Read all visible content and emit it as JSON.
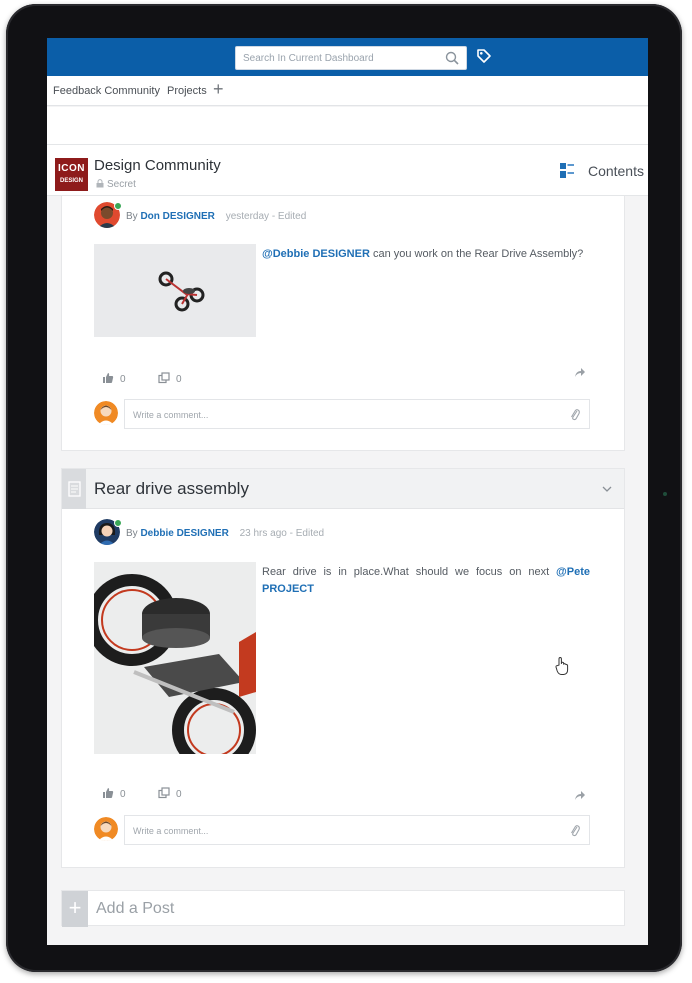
{
  "topbar": {
    "search_placeholder": "Search In Current Dashboard"
  },
  "tabs": [
    {
      "label": "Feedback Community"
    },
    {
      "label": "Projects"
    }
  ],
  "community": {
    "logo_line1": "ICON",
    "logo_line2": "DESIGN",
    "title": "Design Community",
    "privacy": "Secret",
    "contents_label": "Contents"
  },
  "posts": [
    {
      "by": "By",
      "author": "Don DESIGNER",
      "time": "yesterday - Edited",
      "mention": "@Debbie DESIGNER",
      "text": " can you work on the Rear Drive Assembly?",
      "likes": "0",
      "shares": "0",
      "comment_placeholder": "Write a comment..."
    },
    {
      "section_title": "Rear drive assembly",
      "by": "By",
      "author": "Debbie DESIGNER",
      "time": "23 hrs ago - Edited",
      "text": "Rear drive is in place.What should we focus on next ",
      "mention": "@Pete PROJECT",
      "likes": "0",
      "shares": "0",
      "comment_placeholder": "Write a comment..."
    }
  ],
  "add_post": {
    "label": "Add a Post"
  },
  "colors": {
    "brand_blue": "#0b5ea8",
    "link_blue": "#1f6fb5",
    "logo_red": "#8e1b1b"
  }
}
